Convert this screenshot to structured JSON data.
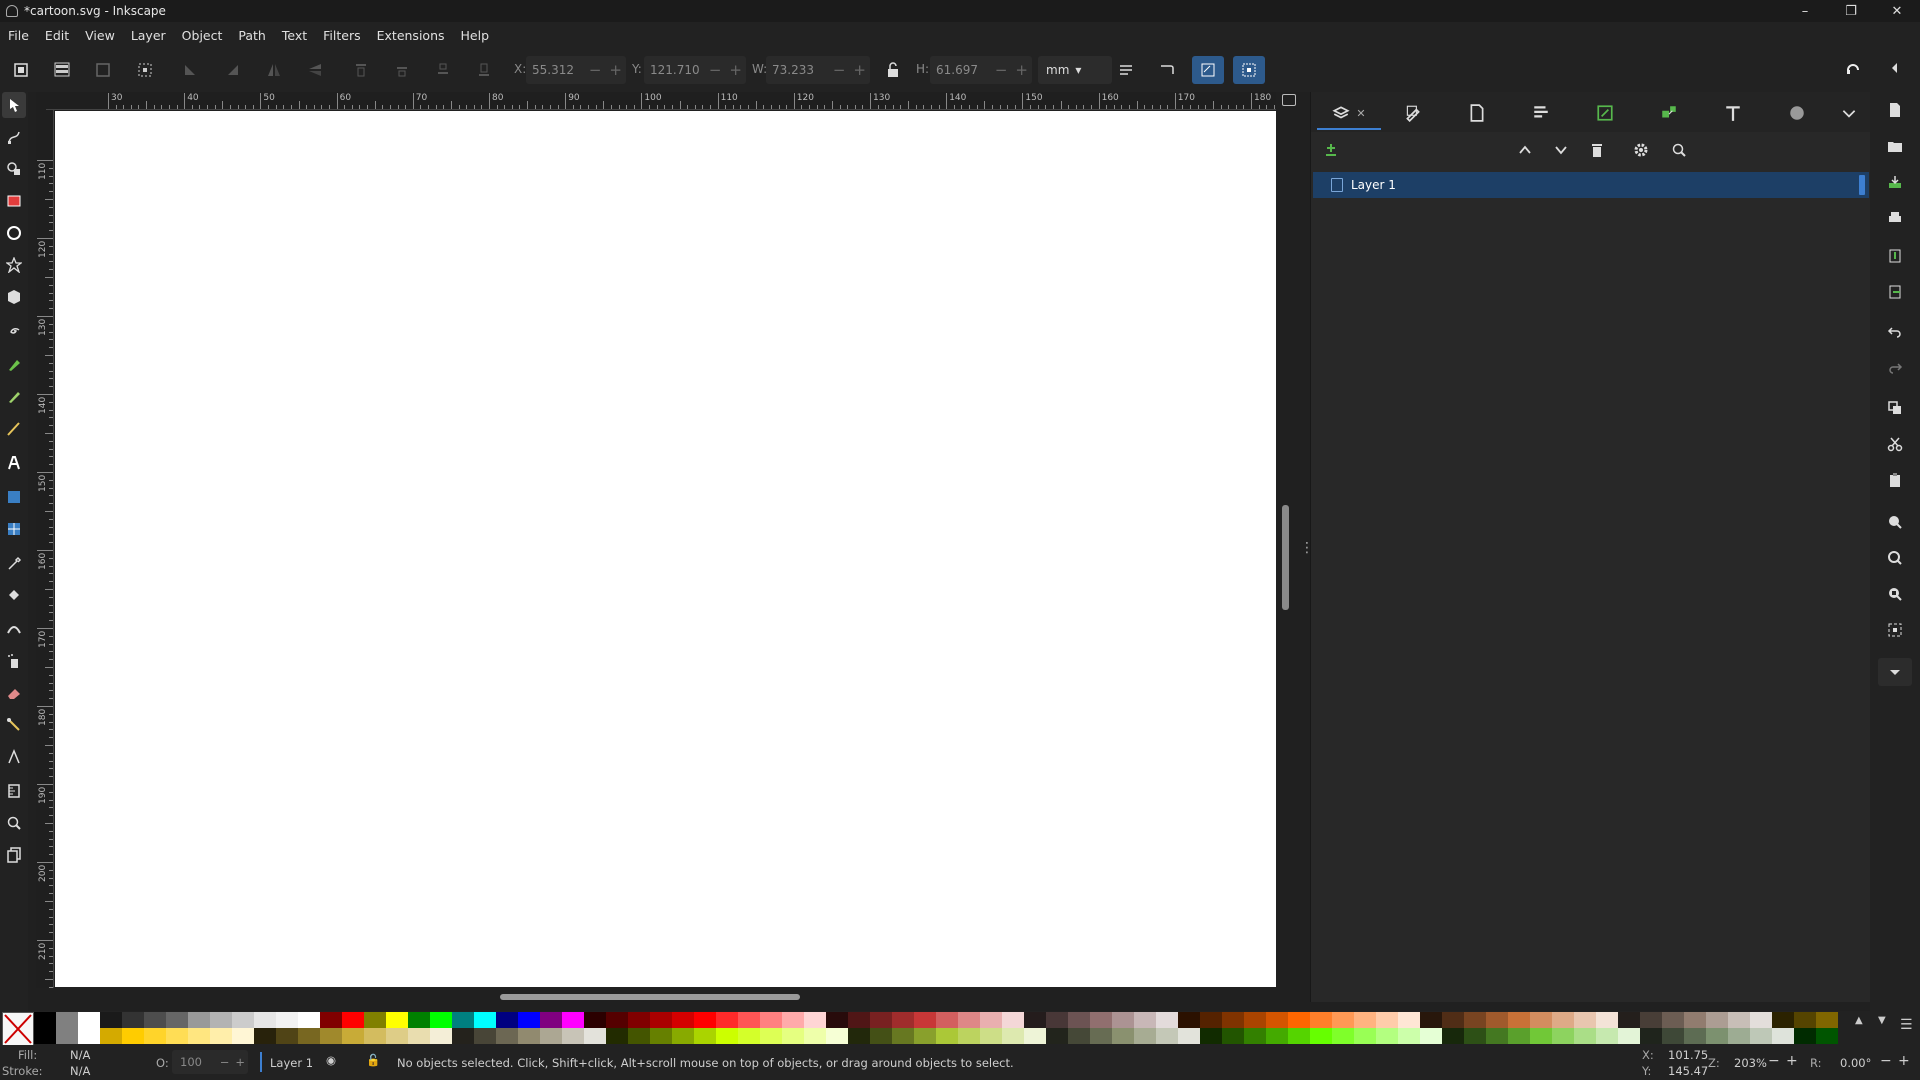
{
  "window": {
    "title": "*cartoon.svg - Inkscape",
    "controls": [
      "–",
      "❐",
      "✕"
    ]
  },
  "menu": [
    "File",
    "Edit",
    "View",
    "Layer",
    "Object",
    "Path",
    "Text",
    "Filters",
    "Extensions",
    "Help"
  ],
  "tool_controls": {
    "x_label": "X:",
    "x_value": "55.312",
    "y_label": "Y:",
    "y_value": "121.710",
    "w_label": "W:",
    "w_value": "73.233",
    "h_label": "H:",
    "h_value": "61.697",
    "unit": "mm"
  },
  "tools": [
    "selector-icon",
    "node-icon",
    "tweak-icon",
    "rectangle-icon",
    "ellipse-icon",
    "star-icon",
    "box3d-icon",
    "spiral-icon",
    "pen-icon",
    "pencil-icon",
    "calligraphy-icon",
    "text-icon",
    "gradient-icon",
    "mesh-icon",
    "dropper-icon",
    "paint-bucket-icon",
    "tweak-brush-icon",
    "spray-icon",
    "eraser-icon",
    "connector-icon",
    "lpe-tool-icon",
    "measure-icon",
    "zoom-icon",
    "pages-icon"
  ],
  "rulers": {
    "horizontal_labels": [
      "30",
      "40",
      "50",
      "60",
      "70",
      "80",
      "90",
      "100",
      "110",
      "120",
      "130",
      "140",
      "150",
      "160",
      "170",
      "180"
    ],
    "vertical_labels": [
      "110",
      "120",
      "130",
      "140",
      "150",
      "160",
      "170",
      "180",
      "190",
      "200",
      "210"
    ]
  },
  "dock": {
    "tabs": [
      "layers-objects-icon",
      "fill-stroke-icon",
      "document-properties-icon",
      "align-distribute-icon",
      "export-icon",
      "xml-editor-icon",
      "text-font-icon",
      "symbols-icon",
      "more-tabs-icon"
    ],
    "layers": [
      {
        "name": "Layer 1",
        "selected": true
      }
    ]
  },
  "right_commands": [
    "new-document-icon",
    "open-icon",
    "save-icon",
    "print-icon",
    "import-icon",
    "export-icon",
    "undo-icon",
    "redo-icon",
    "copy-icon",
    "cut-icon",
    "paste-icon",
    "zoom-selection-icon",
    "zoom-drawing-icon",
    "zoom-page-icon",
    "zoom-center-icon",
    "more-commands-icon"
  ],
  "palette": {
    "top_row": [
      "#000000",
      "#808080",
      "#ffffff",
      "#1a1a1a",
      "#333333",
      "#4d4d4d",
      "#666666",
      "#999999",
      "#b3b3b3",
      "#cccccc",
      "#e6e6e6",
      "#f2f2f2",
      "#ffffff",
      "#800000",
      "#ff0000",
      "#808000",
      "#ffff00",
      "#008000",
      "#00ff00",
      "#008080",
      "#00ffff",
      "#000080",
      "#0000ff",
      "#800080",
      "#ff00ff",
      "#2b0000",
      "#550000",
      "#800000",
      "#aa0000",
      "#d40000",
      "#ff0000",
      "#ff2a2a",
      "#ff5555",
      "#ff8080",
      "#ffaaaa",
      "#ffd5d5",
      "#280b0b",
      "#501616",
      "#782121",
      "#a02c2c",
      "#c83737",
      "#d35f5f",
      "#de8787",
      "#e9afaf",
      "#f4d7d7",
      "#241c1c",
      "#483737",
      "#6c5353",
      "#916f6f",
      "#ac9393",
      "#c8b7b7",
      "#e3dbdb",
      "#2b1100",
      "#552200",
      "#803300",
      "#aa4400",
      "#d45500",
      "#ff6600",
      "#ff7f2a",
      "#ff9955",
      "#ffb380",
      "#ffccaa",
      "#ffe6d5",
      "#28170b",
      "#502d16",
      "#784421",
      "#a05a2c",
      "#c87137",
      "#d38d5f",
      "#deaa87",
      "#e9c6af",
      "#f4e3d7",
      "#241f1c",
      "#483e37",
      "#6c5d53",
      "#917c6f",
      "#ac9d93",
      "#c8beb7",
      "#e3dedb",
      "#2b2200",
      "#554400",
      "#806600",
      "#aa8800"
    ],
    "bottom_row": [
      "#000000",
      "#808080",
      "#ffffff",
      "#d4aa00",
      "#ffcc00",
      "#ffd42a",
      "#ffdd55",
      "#ffe680",
      "#ffeeaa",
      "#fff6d5",
      "#28220b",
      "#504416",
      "#786721",
      "#a0892c",
      "#c8ab37",
      "#d3bc5f",
      "#decd87",
      "#e9ddaf",
      "#f4eed7",
      "#24221c",
      "#484537",
      "#6c6753",
      "#918a6f",
      "#aca793",
      "#c8c4b7",
      "#e3e2db",
      "#222b00",
      "#445500",
      "#668000",
      "#88aa00",
      "#aad400",
      "#ccff00",
      "#d4ff2a",
      "#ddff55",
      "#e5ff80",
      "#eeffaa",
      "#f6ffd5",
      "#22280b",
      "#445016",
      "#677821",
      "#89a02c",
      "#abc837",
      "#bcd35f",
      "#cdde87",
      "#dde9af",
      "#eef4d7",
      "#22241c",
      "#454837",
      "#676c53",
      "#8a916f",
      "#a7ac93",
      "#c4c8b7",
      "#e2e3db",
      "#112b00",
      "#225500",
      "#338000",
      "#44aa00",
      "#55d400",
      "#66ff00",
      "#7fff2a",
      "#99ff55",
      "#b3ff80",
      "#ccffaa",
      "#e5ffd5",
      "#17280b",
      "#2d5016",
      "#447821",
      "#5aa02c",
      "#71c837",
      "#8dd35f",
      "#aade87",
      "#c6e9af",
      "#e3f4d7",
      "#1f241c",
      "#3e4837",
      "#5d6c53",
      "#7c916f",
      "#9dac93",
      "#bec8b7",
      "#dee3db",
      "#002b00",
      "#005500",
      "#008000",
      "#00aa00"
    ]
  },
  "status": {
    "fill_label": "Fill:",
    "fill_value": "N/A",
    "stroke_label": "Stroke:",
    "stroke_value": "N/A",
    "opacity_label": "O:",
    "opacity_value": "100",
    "layer": "Layer 1",
    "message": "No objects selected. Click, Shift+click, Alt+scroll mouse on top of objects, or drag around objects to select.",
    "cursor_x_label": "X:",
    "cursor_x": "101.75",
    "cursor_y_label": "Y:",
    "cursor_y": "145.47",
    "zoom_label": "Z:",
    "zoom": "203%",
    "rotation_label": "R:",
    "rotation": "0.00°"
  }
}
